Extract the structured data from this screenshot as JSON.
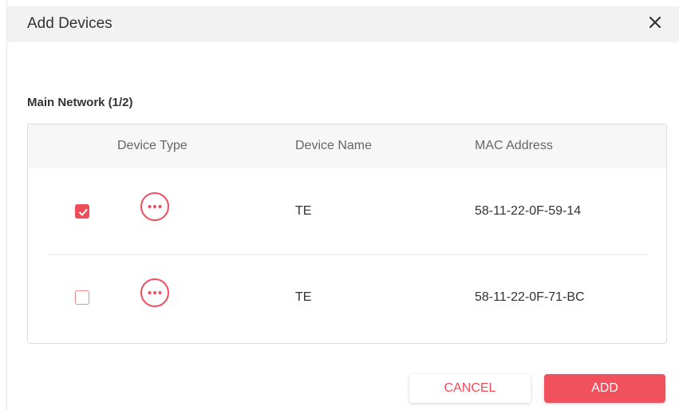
{
  "dialog": {
    "title": "Add Devices",
    "close_icon": "close-icon"
  },
  "section": {
    "title": "Main Network (1/2)"
  },
  "table": {
    "columns": [
      "",
      "Device Type",
      "Device Name",
      "MAC Address"
    ],
    "rows": [
      {
        "selected": true,
        "device_type_icon": "more-options-icon",
        "device_name": "TE",
        "mac": "58-11-22-0F-59-14"
      },
      {
        "selected": false,
        "device_type_icon": "more-options-icon",
        "device_name": "TE",
        "mac": "58-11-22-0F-71-BC"
      }
    ]
  },
  "footer": {
    "cancel_label": "CANCEL",
    "add_label": "ADD"
  },
  "colors": {
    "accent": "#ef4d5a",
    "header_bg": "#f2f2f2",
    "text": "#333333"
  }
}
